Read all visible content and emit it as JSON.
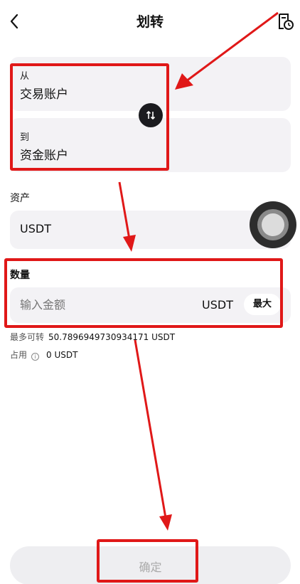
{
  "header": {
    "title": "划转",
    "back_icon": "chevron-left-icon",
    "record_icon": "transfer-record-icon"
  },
  "transfer": {
    "from_label": "从",
    "from_value": "交易账户",
    "to_label": "到",
    "to_value": "资金账户",
    "swap_icon": "swap-arrows-icon"
  },
  "asset": {
    "label": "资产",
    "value": "USDT"
  },
  "amount": {
    "label": "数量",
    "placeholder": "输入金额",
    "unit": "USDT",
    "max_label": "最大"
  },
  "info": {
    "max_transferable_label": "最多可转",
    "max_transferable_value": "50.7896949730934171 USDT",
    "occupied_label": "占用",
    "occupied_value": "0 USDT"
  },
  "confirm_label": "确定",
  "colors": {
    "annotation_red": "#e01818",
    "card_bg": "#f3f2f5",
    "swap_bg": "#1b1b1f"
  }
}
